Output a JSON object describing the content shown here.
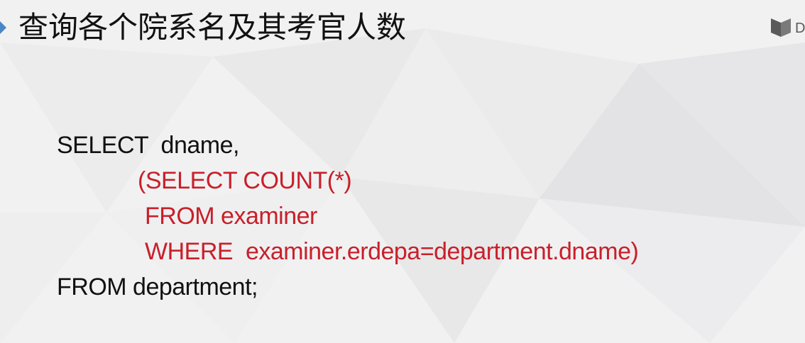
{
  "slide": {
    "title": "查询各个院系名及其考官人数",
    "background_color": "#f1f1f2",
    "accent_color": "#4a86c5",
    "code_color": "#111111",
    "highlight_color": "#c8202a",
    "logo_icon": "book-icon",
    "logo_text": "D"
  },
  "code": {
    "line1": "SELECT  dname,",
    "line2": "(SELECT COUNT(*)",
    "line3": "FROM examiner",
    "line4": "WHERE  examiner.erdepa=department.dname)",
    "line5": "FROM department;"
  }
}
